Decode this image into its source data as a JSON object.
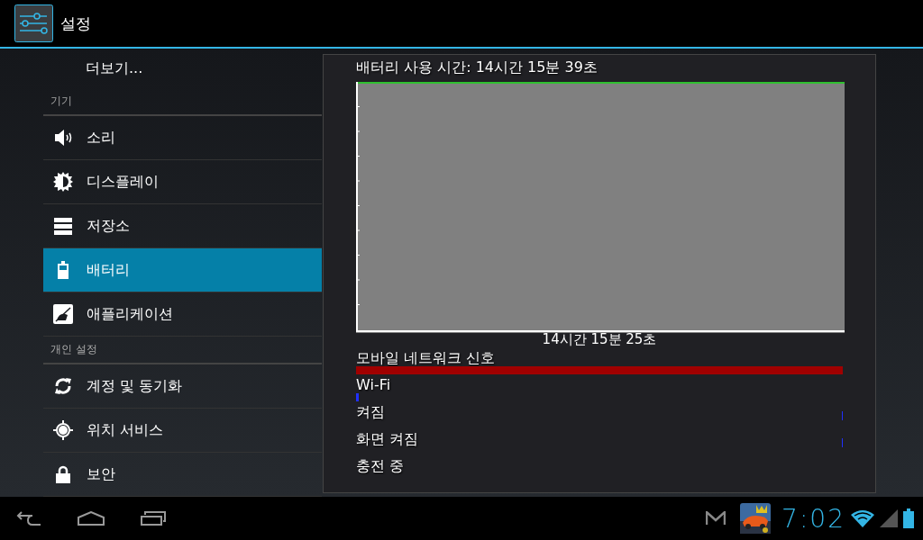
{
  "app_bar": {
    "title": "설정"
  },
  "sidebar": {
    "items": [
      {
        "kind": "link",
        "label": "더보기...",
        "selected": false
      },
      {
        "kind": "header",
        "label": "기기"
      },
      {
        "kind": "item",
        "label": "소리",
        "selected": false
      },
      {
        "kind": "item",
        "label": "디스플레이",
        "selected": false
      },
      {
        "kind": "item",
        "label": "저장소",
        "selected": false
      },
      {
        "kind": "item",
        "label": "배터리",
        "selected": true
      },
      {
        "kind": "item",
        "label": "애플리케이션",
        "selected": false
      },
      {
        "kind": "header",
        "label": "개인 설정"
      },
      {
        "kind": "item",
        "label": "계정 및 동기화",
        "selected": false
      },
      {
        "kind": "item",
        "label": "위치 서비스",
        "selected": false
      },
      {
        "kind": "item",
        "label": "보안",
        "selected": false
      }
    ]
  },
  "detail": {
    "title": "배터리 사용 시간: 14시간 15분 39초",
    "graph_label": "14시간 15분 25초",
    "rows": [
      {
        "label": "모바일 네트워크 신호",
        "kind": "full",
        "color": "#a00000"
      },
      {
        "label": "Wi-Fi",
        "kind": "start",
        "color": "#2030ff"
      },
      {
        "label": "켜짐",
        "kind": "end",
        "color": "#2030ff"
      },
      {
        "label": "화면 켜짐",
        "kind": "end",
        "color": "#2030ff"
      },
      {
        "label": "충전 중",
        "kind": "none"
      }
    ]
  },
  "status_bar": {
    "time": "7:02"
  }
}
